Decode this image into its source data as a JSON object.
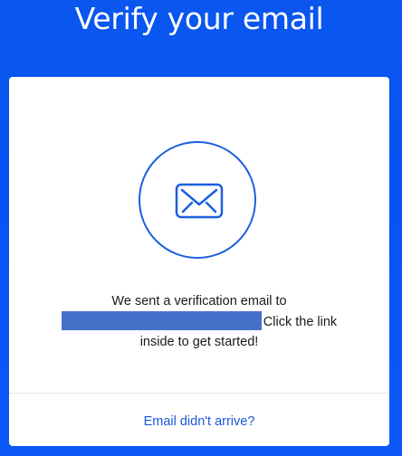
{
  "header": {
    "title": "Verify your email"
  },
  "card": {
    "icon": "envelope-icon",
    "message_line1": "We sent a verification email to",
    "message_line2_suffix": "Click the link",
    "message_line3": "inside to get started!",
    "link_label": "Email didn't arrive?"
  },
  "colors": {
    "background": "#0654f2",
    "accent": "#1a5fe0",
    "link": "#1957d8",
    "redaction": "#4670c8"
  }
}
